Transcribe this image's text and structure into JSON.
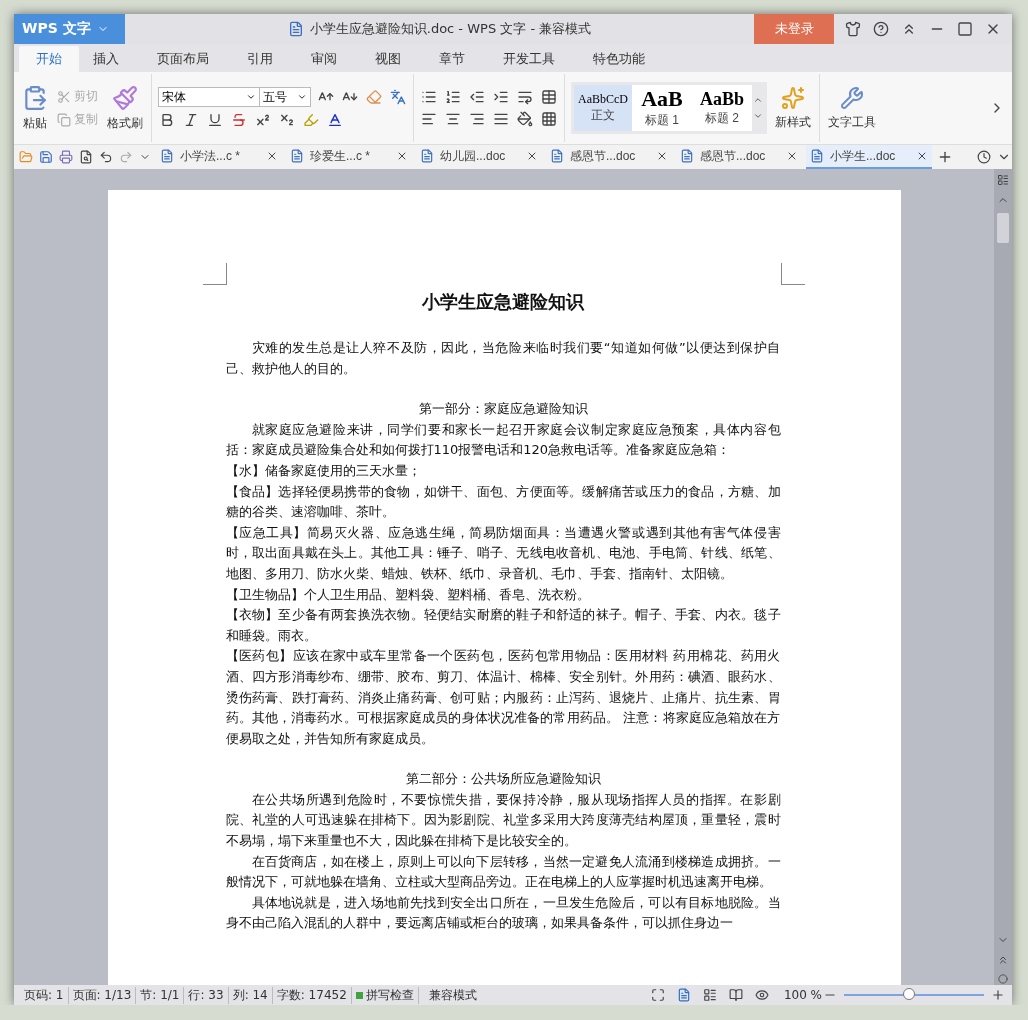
{
  "window": {
    "app_button": "WPS 文字",
    "title": "小学生应急避险知识.doc - WPS 文字 - 兼容模式",
    "login_button": "未登录"
  },
  "menu_tabs": [
    {
      "label": "开始",
      "selected": true
    },
    {
      "label": "插入",
      "selected": false
    },
    {
      "label": "页面布局",
      "selected": false
    },
    {
      "label": "引用",
      "selected": false
    },
    {
      "label": "审阅",
      "selected": false
    },
    {
      "label": "视图",
      "selected": false
    },
    {
      "label": "章节",
      "selected": false
    },
    {
      "label": "开发工具",
      "selected": false
    },
    {
      "label": "特色功能",
      "selected": false
    }
  ],
  "ribbon": {
    "paste": "粘贴",
    "cut": {
      "label": "剪切",
      "disabled": true
    },
    "copy": {
      "label": "复制",
      "disabled": true
    },
    "format_painter": "格式刷",
    "font_name": "宋体",
    "font_size": "五号",
    "styles": [
      {
        "preview": "AaBbCcD",
        "label": "正文",
        "selected": true
      },
      {
        "preview": "AaB",
        "label": "标题 1",
        "selected": false
      },
      {
        "preview": "AaBb",
        "label": "标题 2",
        "selected": false
      }
    ],
    "new_style": "新样式",
    "text_tools": "文字工具"
  },
  "doc_tabs": [
    {
      "label": "小学法...c *",
      "selected": false
    },
    {
      "label": "珍爱生...c *",
      "selected": false
    },
    {
      "label": "幼儿园...doc",
      "selected": false
    },
    {
      "label": "感恩节...doc",
      "selected": false
    },
    {
      "label": "感恩节...doc",
      "selected": false
    },
    {
      "label": "小学生...doc",
      "selected": true
    }
  ],
  "document": {
    "title": "小学生应急避险知识",
    "paragraphs": [
      {
        "kind": "intro",
        "text": "灾难的发生总是让人猝不及防，因此，当危险来临时我们要“知道如何做”以便达到保护自己、救护他人的目的。"
      },
      {
        "kind": "heading",
        "text": "第一部分：家庭应急避险知识"
      },
      {
        "kind": "para",
        "text": "就家庭应急避险来讲，同学们要和家长一起召开家庭会议制定家庭应急预案，具体内容包括：家庭成员避险集合处和如何拨打110报警电话和120急救电话等。准备家庭应急箱："
      },
      {
        "kind": "item",
        "text": "【水】储备家庭使用的三天水量；"
      },
      {
        "kind": "item",
        "text": "【食品】选择轻便易携带的食物，如饼干、面包、方便面等。缓解痛苦或压力的食品，方糖、加糖的谷类、速溶咖啡、茶叶。"
      },
      {
        "kind": "item",
        "text": "【应急工具】简易灭火器、应急逃生绳，简易防烟面具：当遭遇火警或遇到其他有害气体侵害时，取出面具戴在头上。其他工具：锤子、哨子、无线电收音机、电池、手电筒、针线、纸笔、地图、多用刀、防水火柴、蜡烛、铁杯、纸巾、录音机、毛巾、手套、指南针、太阳镜。"
      },
      {
        "kind": "item",
        "text": "【卫生物品】个人卫生用品、塑料袋、塑料桶、香皂、洗衣粉。"
      },
      {
        "kind": "item",
        "text": "【衣物】至少备有两套换洗衣物。轻便结实耐磨的鞋子和舒适的袜子。帽子、手套、内衣。毯子和睡袋。雨衣。"
      },
      {
        "kind": "item",
        "text": "【医药包】应该在家中或车里常备一个医药包，医药包常用物品：医用材料 药用棉花、药用火酒、四方形消毒纱布、绷带、胶布、剪刀、体温计、棉棒、安全别针。外用药：碘酒、眼药水、烫伤药膏、跌打膏药、消炎止痛药膏、创可贴；内服药：止泻药、退烧片、止痛片、抗生素、胃药。其他，消毒药水。可根据家庭成员的身体状况准备的常用药品。 注意：将家庭应急箱放在方便易取之处，并告知所有家庭成员。"
      },
      {
        "kind": "heading",
        "text": "第二部分：公共场所应急避险知识"
      },
      {
        "kind": "para",
        "text": "在公共场所遇到危险时，不要惊慌失措，要保持冷静，服从现场指挥人员的指挥。在影剧院、礼堂的人可迅速躲在排椅下。因为影剧院、礼堂多采用大跨度薄壳结构屋顶，重量轻，震时不易塌，塌下来重量也不大，因此躲在排椅下是比较安全的。"
      },
      {
        "kind": "para",
        "text": "在百货商店，如在楼上，原则上可以向下层转移，当然一定避免人流涌到楼梯造成拥挤。一般情况下，可就地躲在墙角、立柱或大型商品旁边。正在电梯上的人应掌握时机迅速离开电梯。"
      },
      {
        "kind": "para",
        "text": "具体地说就是，进入场地前先找到安全出口所在，一旦发生危险后，可以有目标地脱险。当身不由己陷入混乱的人群中，要远离店铺或柜台的玻璃，如果具备条件，可以抓住身边一"
      }
    ]
  },
  "status_bar": {
    "items": [
      "页码: 1",
      "页面: 1/13",
      "节: 1/1",
      "行: 33",
      "列: 14",
      "字数: 17452"
    ],
    "spell_check": "拼写检查",
    "mode": "兼容模式",
    "zoom": "100 %",
    "zoom_slider": {
      "level": 0.47
    }
  }
}
